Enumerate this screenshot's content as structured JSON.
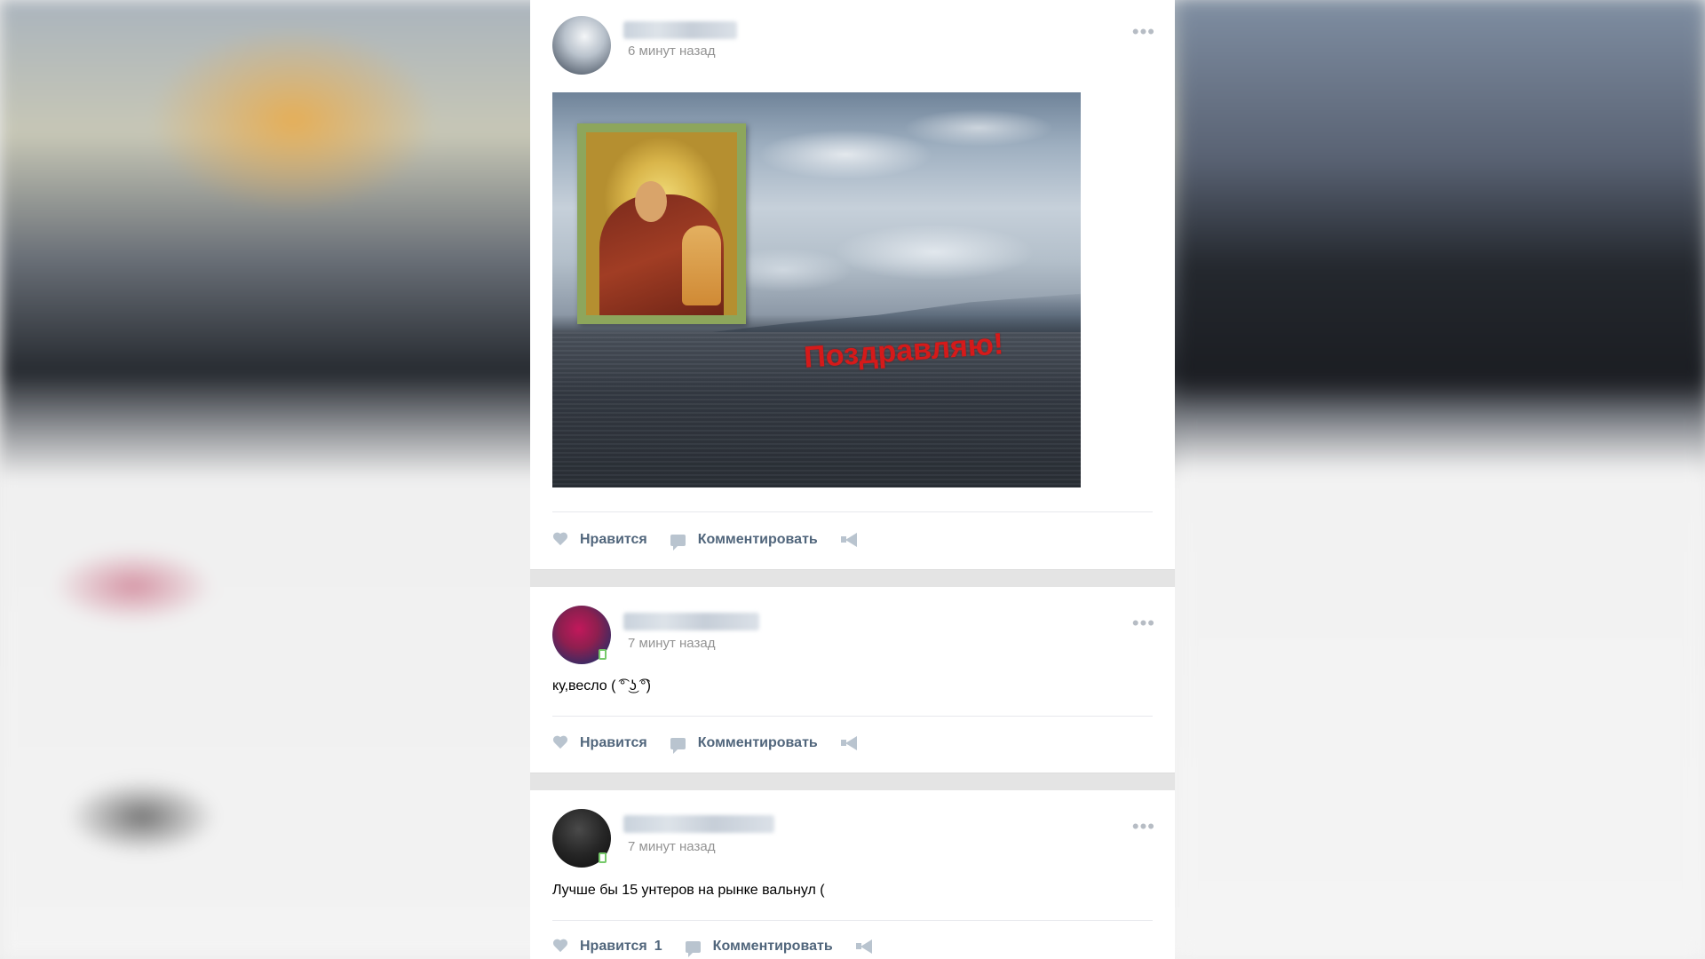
{
  "colors": {
    "feed_background": "#e4e4e4",
    "card_background": "#ffffff",
    "action_text": "#51667c",
    "timestamp_text": "#939393",
    "caption_red": "#d51a1a"
  },
  "posts": [
    {
      "timestamp": "6 минут назад",
      "more_icon": "more-dots-icon",
      "photo": {
        "caption": "Поздравляю!"
      },
      "actions": {
        "like_label": "Нравится",
        "comment_label": "Комментировать"
      }
    },
    {
      "timestamp": "7 минут назад",
      "text": "ку,весло ( ͡° ͜ʖ ͡°)",
      "actions": {
        "like_label": "Нравится",
        "comment_label": "Комментировать"
      }
    },
    {
      "timestamp": "7 минут назад",
      "text": "Лучше бы 15 унтеров на рынке вальнул (",
      "actions": {
        "like_label": "Нравится",
        "like_count": "1",
        "comment_label": "Комментировать"
      }
    }
  ]
}
